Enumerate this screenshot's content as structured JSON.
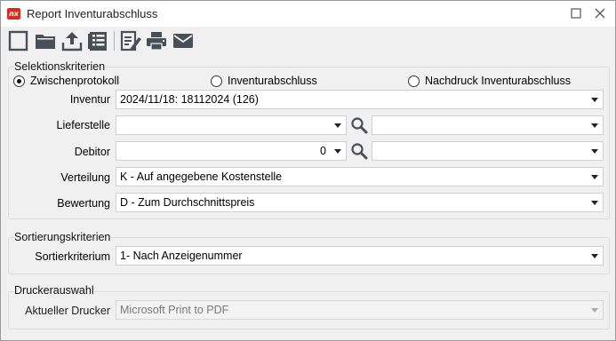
{
  "window": {
    "title": "Report Inventurabschluss",
    "app_icon_text": "nx",
    "maximize_icon": "square-icon",
    "close_icon": "close-icon"
  },
  "toolbar": {
    "buttons": [
      {
        "name": "new-document-button",
        "icon": "blank-page-icon"
      },
      {
        "name": "open-folder-button",
        "icon": "folder-icon"
      },
      {
        "name": "export-upload-button",
        "icon": "upload-icon"
      },
      {
        "name": "list-report-button",
        "icon": "list-icon"
      },
      {
        "name": "edit-document-button",
        "icon": "edit-icon"
      },
      {
        "name": "print-button",
        "icon": "printer-icon"
      },
      {
        "name": "email-button",
        "icon": "envelope-icon"
      }
    ]
  },
  "selektion": {
    "title": "Selektionskriterien",
    "radios": [
      {
        "label": "Zwischenprotokoll",
        "checked": true
      },
      {
        "label": "Inventurabschluss",
        "checked": false
      },
      {
        "label": "Nachdruck Inventurabschluss",
        "checked": false
      }
    ],
    "inventur": {
      "label": "Inventur",
      "value": "2024/11/18: 18112024 (126)"
    },
    "lieferstelle": {
      "label": "Lieferstelle",
      "value": "",
      "secondary_value": ""
    },
    "debitor": {
      "label": "Debitor",
      "value": "0",
      "secondary_value": ""
    },
    "verteilung": {
      "label": "Verteilung",
      "value": "K - Auf angegebene Kostenstelle"
    },
    "bewertung": {
      "label": "Bewertung",
      "value": "D - Zum Durchschnittspreis"
    }
  },
  "sortierung": {
    "title": "Sortierungskriterien",
    "kriterium": {
      "label": "Sortierkriterium",
      "value": "1- Nach Anzeigenummer"
    }
  },
  "drucker": {
    "title": "Druckerauswahl",
    "aktuell": {
      "label": "Aktueller Drucker",
      "value": "Microsoft Print to PDF"
    }
  },
  "colors": {
    "app_icon": "#d92b1f",
    "toolbar_icon": "#4a4f57",
    "window_bg": "#f0f0f0"
  }
}
